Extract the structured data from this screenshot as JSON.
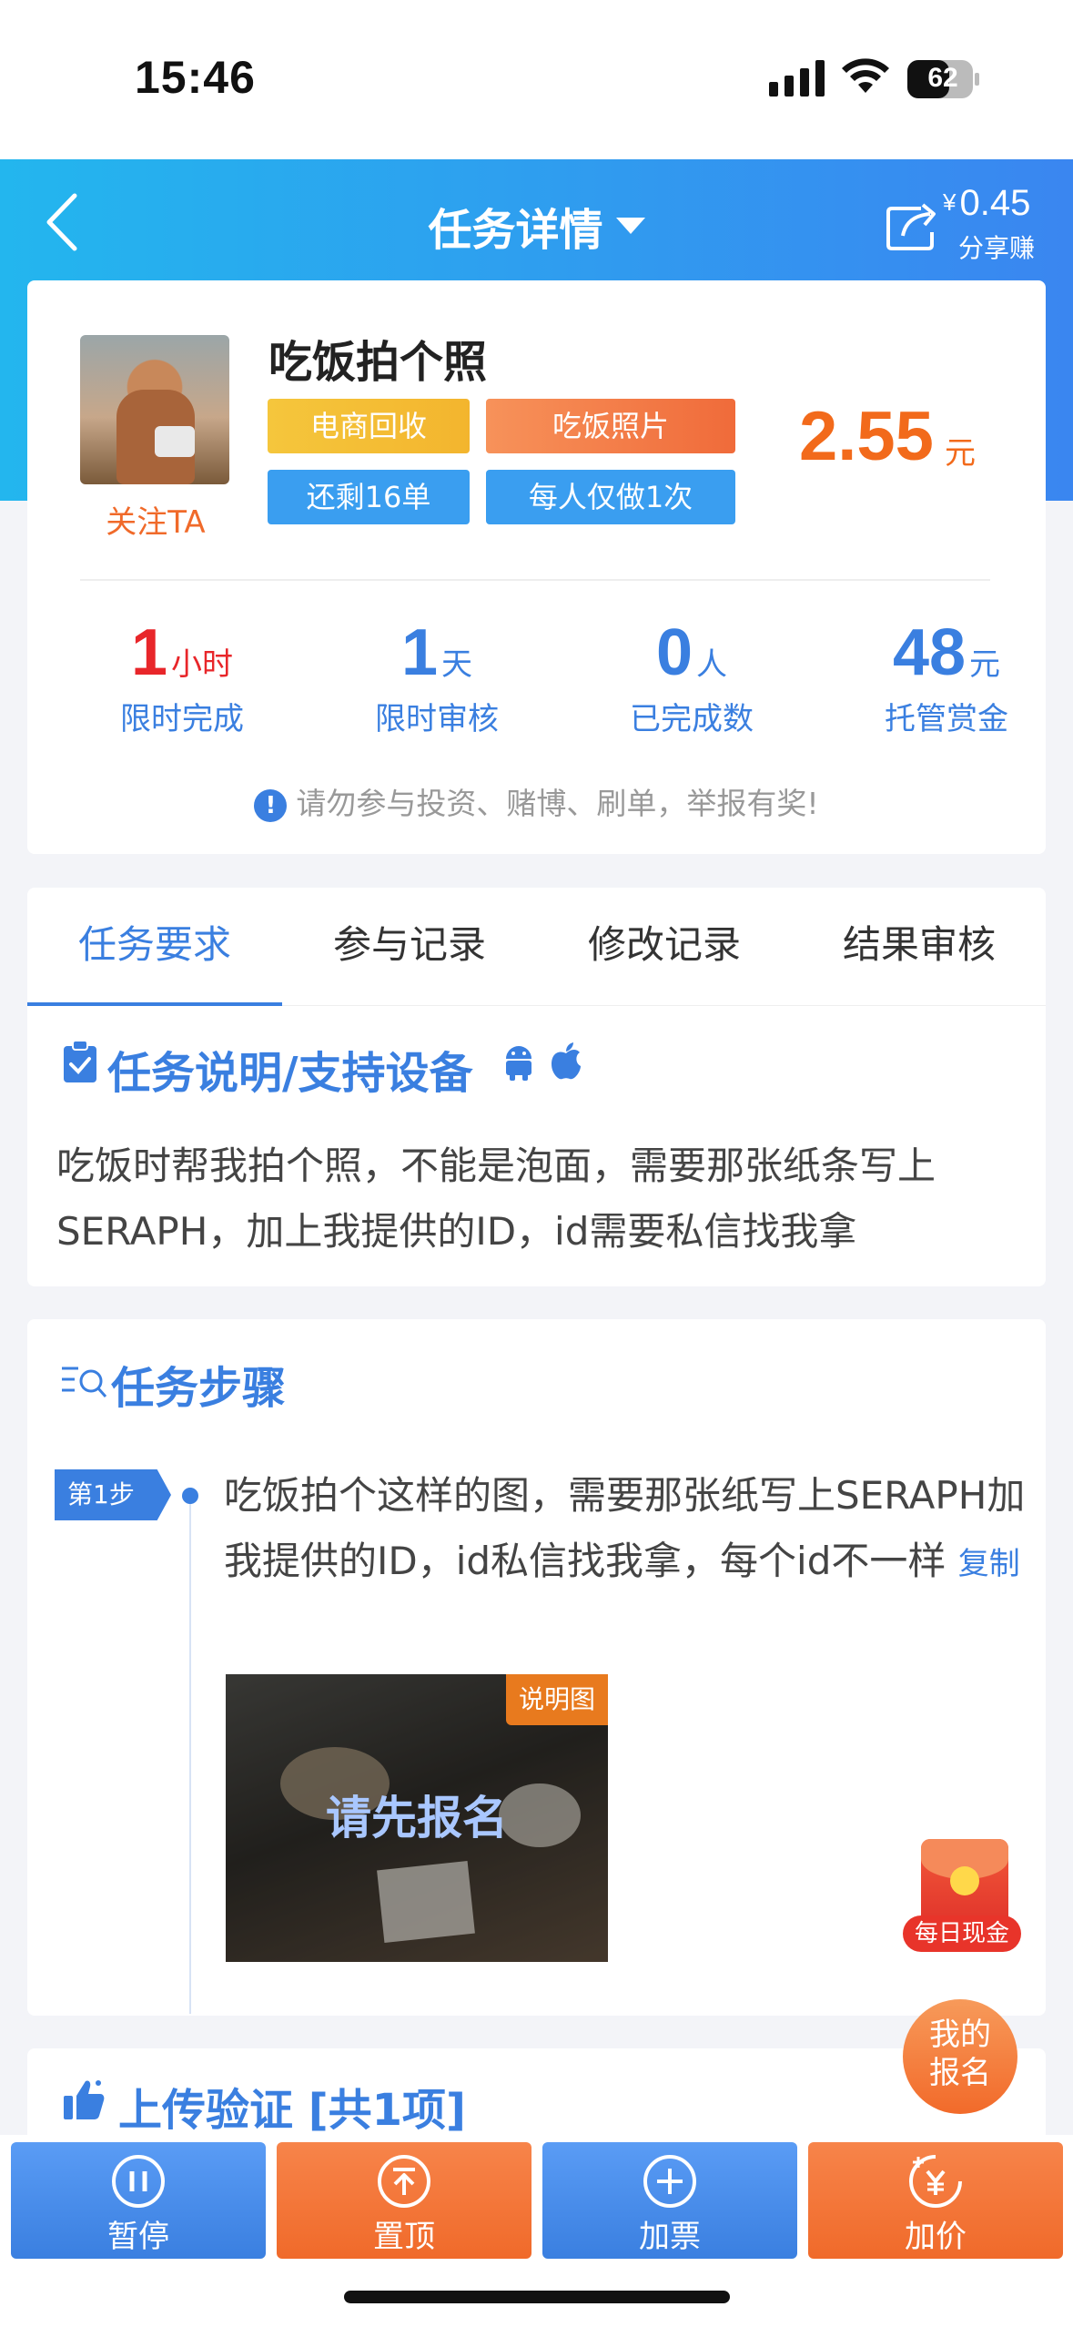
{
  "status_bar": {
    "time": "15:46",
    "battery": "62"
  },
  "header": {
    "title": "任务详情",
    "share": {
      "currency": "¥",
      "amount": "0.45",
      "label": "分享赚"
    }
  },
  "task": {
    "name": "吃饭拍个照",
    "follow_label": "关注TA",
    "tags": [
      "电商回收",
      "吃饭照片",
      "还剩16单",
      "每人仅做1次"
    ],
    "price": "2.55",
    "price_unit": "元"
  },
  "stats": [
    {
      "value": "1",
      "unit": "小时",
      "label": "限时完成"
    },
    {
      "value": "1",
      "unit": "天",
      "label": "限时审核"
    },
    {
      "value": "0",
      "unit": "人",
      "label": "已完成数"
    },
    {
      "value": "48",
      "unit": "元",
      "label": "托管赏金"
    }
  ],
  "warning": "请勿参与投资、赌博、刷单，举报有奖!",
  "tabs": [
    "任务要求",
    "参与记录",
    "修改记录",
    "结果审核"
  ],
  "description": {
    "title": "任务说明/支持设备",
    "text": "吃饭时帮我拍个照，不能是泡面，需要那张纸条写上SERAPH，加上我提供的ID，id需要私信找我拿"
  },
  "steps": {
    "title": "任务步骤",
    "items": [
      {
        "badge": "第1步",
        "text": "吃饭拍个这样的图，需要那张纸写上SERAPH加我提供的ID，id私信找我拿，每个id不一样",
        "copy_label": "复制",
        "image_tag": "说明图",
        "image_cta": "请先报名"
      }
    ]
  },
  "upload": {
    "title": "上传验证 [共1项]"
  },
  "floats": {
    "daily_cash": "每日现金",
    "my_signup_line1": "我的",
    "my_signup_line2": "报名"
  },
  "actions": [
    {
      "label": "暂停",
      "icon": "pause-icon"
    },
    {
      "label": "置顶",
      "icon": "pin-top-icon"
    },
    {
      "label": "加票",
      "icon": "plus-icon"
    },
    {
      "label": "加价",
      "icon": "raise-price-icon"
    }
  ],
  "colors": {
    "primary": "#3a7fe0",
    "accent": "#f06a2a",
    "price": "#f26a1b",
    "danger": "#e8262a"
  }
}
